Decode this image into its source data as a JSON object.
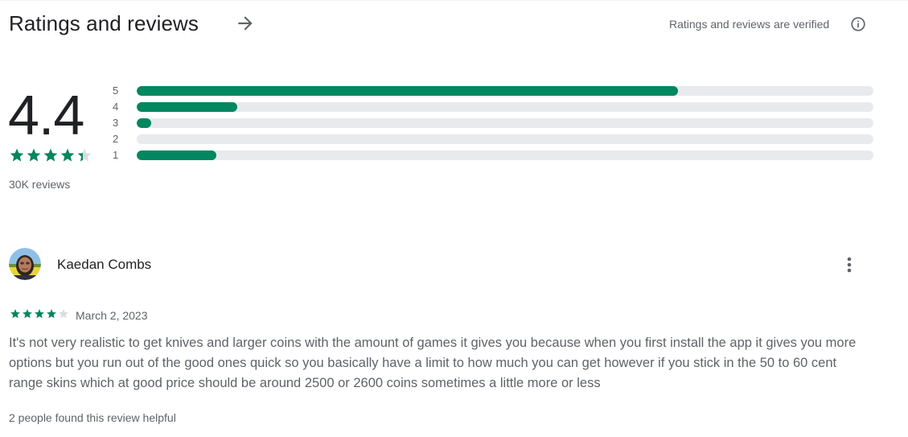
{
  "header": {
    "title": "Ratings and reviews",
    "verified_text": "Ratings and reviews are verified",
    "arrow_icon": "arrow-right-icon",
    "info_icon": "info-icon"
  },
  "summary": {
    "score": "4.4",
    "star_rating": 4.4,
    "review_count": "30K reviews"
  },
  "histogram": [
    {
      "label": "5",
      "fraction": 0.735
    },
    {
      "label": "4",
      "fraction": 0.137
    },
    {
      "label": "3",
      "fraction": 0.02
    },
    {
      "label": "2",
      "fraction": 0.0
    },
    {
      "label": "1",
      "fraction": 0.108
    }
  ],
  "review": {
    "author": "Kaedan Combs",
    "avatar_icon": "user-avatar",
    "rating": 4,
    "date": "March 2, 2023",
    "body": "It's not very realistic to get knives and larger coins with the amount of games it gives you because when you first install the app it gives you more options but you run out of the good ones quick so you basically have a limit to how much you can get however if you stick in the 50 to 60 cent range skins which at good price should be around 2500 or 2600 coins sometimes a little more or less",
    "helpful_text": "2 people found this review helpful",
    "menu_icon": "more-vert-icon"
  },
  "colors": {
    "accent": "#01875f",
    "track": "#e8eaed",
    "star_empty": "#dadce0",
    "text_primary": "#202124",
    "text_secondary": "#5f6368"
  }
}
